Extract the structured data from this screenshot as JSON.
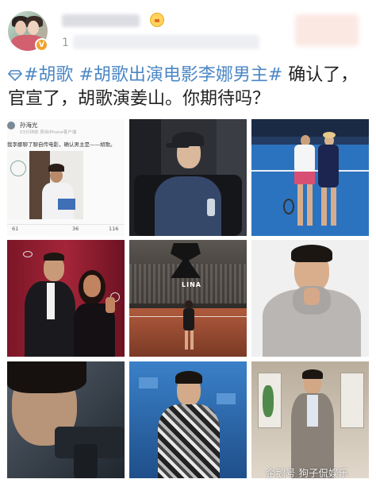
{
  "post": {
    "meta_prefix": "1",
    "hashtag_1": "#胡歌",
    "hashtag_2": "#胡歌出演电影李娜男主#",
    "body": " 确认了，官宣了，胡歌演姜山。你期待吗？"
  },
  "images": {
    "first": {
      "author": "孙海光",
      "time": "03分钟前 来自iPhone客户端",
      "text": "我李娜聊了聊自传电影，确认男主是——胡歌。",
      "stats": [
        "61",
        "36",
        "116"
      ]
    },
    "fifth": {
      "poster_text": "LINA"
    },
    "ninth": {
      "watermark": "企鹅号 狗子侃娱乐"
    }
  },
  "colors": {
    "hashtag": "#4b87c4",
    "verified": "#f0a32f"
  }
}
